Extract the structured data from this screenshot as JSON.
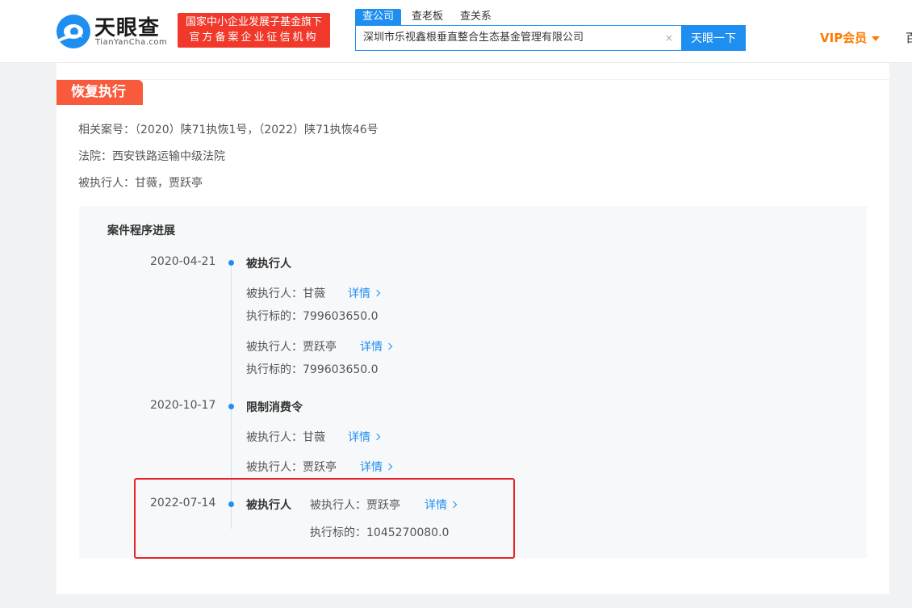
{
  "header": {
    "logo_text": "天眼查",
    "logo_sub": "TianYanCha.com",
    "slogan_line1": "国家中小企业发展子基金旗下",
    "slogan_line2": "官方备案企业征信机构",
    "tabs": [
      {
        "label": "查公司"
      },
      {
        "label": "查老板"
      },
      {
        "label": "查关系"
      }
    ],
    "search_value": "深圳市乐视鑫根垂直整合生态基金管理有限公司",
    "clear_symbol": "×",
    "search_button": "天眼一下",
    "vip_label": "VIP会员",
    "cut_text": "百"
  },
  "section": {
    "tag": "恢复执行",
    "case_numbers": "相关案号：（2020）陕71执恢1号，（2022）陕71执恢46号",
    "court": "法院：西安铁路运输中级法院",
    "executed_persons": "被执行人：甘薇，贾跃亭"
  },
  "progress": {
    "title": "案件程序进展",
    "detail_label": "详情",
    "events": [
      {
        "date": "2020-04-21",
        "title": "被执行人",
        "lines": [
          "被执行人：甘薇",
          "执行标的：799603650.0",
          "被执行人：贾跃亭",
          "执行标的：799603650.0"
        ]
      },
      {
        "date": "2020-10-17",
        "title": "限制消费令",
        "lines": [
          "被执行人：甘薇",
          "被执行人：贾跃亭"
        ]
      },
      {
        "date": "2022-07-14",
        "title": "被执行人",
        "lines": [
          "被执行人：贾跃亭",
          "执行标的：1045270080.0"
        ]
      }
    ]
  },
  "colors": {
    "brand_blue": "#1f8ef1",
    "tag_orange": "#fa5a3c",
    "vip_orange": "#ff7a00",
    "highlight_red": "#e9232a"
  }
}
